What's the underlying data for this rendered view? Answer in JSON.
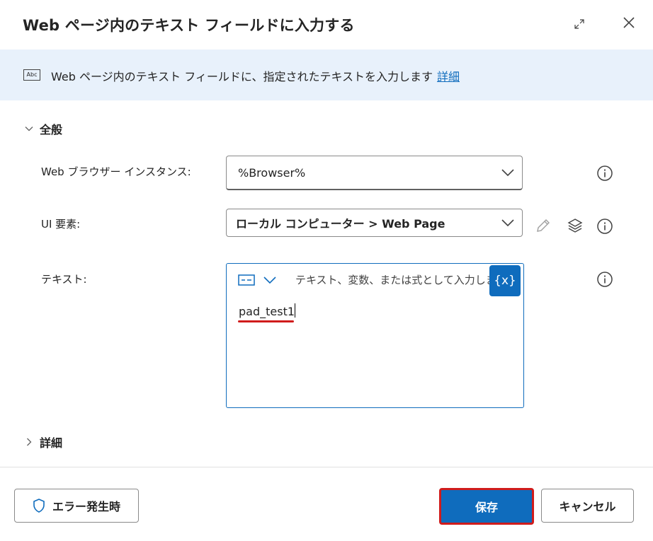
{
  "dialog": {
    "title": "Web ページ内のテキスト フィールドに入力する"
  },
  "banner": {
    "icon": "abc-text-icon",
    "icon_label": "Abc",
    "text": "Web ページ内のテキスト フィールドに、指定されたテキストを入力します",
    "link": "詳細"
  },
  "general": {
    "label": "全般",
    "expanded": true
  },
  "fields": {
    "browser": {
      "label": "Web ブラウザー インスタンス:",
      "value": "%Browser%"
    },
    "ui_element": {
      "label": "UI 要素:",
      "value": "ローカル コンピューター > Web Page"
    },
    "text": {
      "label": "テキスト:",
      "placeholder": "テキスト、変数、または式として入力しま",
      "value": "pad_test1",
      "variable_button": "{x}"
    }
  },
  "advanced": {
    "label": "詳細",
    "expanded": false
  },
  "footer": {
    "on_error_label": "エラー発生時",
    "save_label": "保存",
    "cancel_label": "キャンセル"
  },
  "colors": {
    "accent": "#0f6cbd",
    "banner_bg": "#e8f1fb",
    "highlight_red": "#d01c1c"
  }
}
